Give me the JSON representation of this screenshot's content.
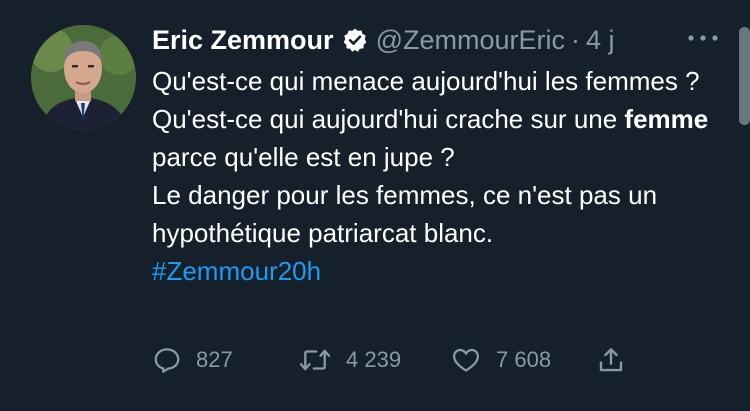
{
  "tweet": {
    "author_name": "Eric Zemmour",
    "verified": true,
    "handle": "@ZemmourEric",
    "separator": "·",
    "time": "4 j",
    "text_part1": "Qu'est-ce qui menace aujourd'hui les femmes ? Qu'est-ce qui aujourd'hui crache sur une ",
    "text_bold": "femme",
    "text_part2": " parce qu'elle est en jupe ?",
    "text_line2": "Le danger pour les femmes, ce n'est pas un hypothétique patriarcat blanc.",
    "hashtag": "#Zemmour20h",
    "replies": "827",
    "retweets": "4 239",
    "likes": "7 608"
  },
  "icons": {
    "verified": "verified-badge-icon",
    "more": "more-horizontal-icon",
    "reply": "reply-icon",
    "retweet": "retweet-icon",
    "like": "heart-icon",
    "share": "share-icon"
  },
  "colors": {
    "background": "#15202b",
    "text": "#ffffff",
    "muted": "#8b98a5",
    "link": "#1d9bf0"
  }
}
